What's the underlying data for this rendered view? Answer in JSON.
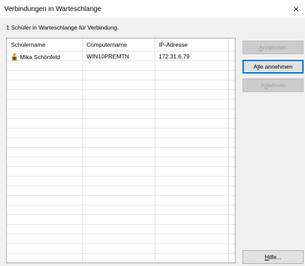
{
  "window": {
    "title": "Verbindungen in Warteschlange",
    "close_glyph": "×"
  },
  "info_text": "1 Schüler in Warteschlange für Verbindung.",
  "table": {
    "columns": [
      "Schülername",
      "Computername",
      "IP-Adresse"
    ],
    "rows": [
      {
        "student": "Mika Schönfeld",
        "computer": "WIN10PREMTN",
        "ip": "172.31.6.79",
        "icon": "student-icon"
      }
    ]
  },
  "buttons": {
    "accept": {
      "pre": "",
      "mnemonic": "A",
      "post": "nnehmen",
      "enabled": false
    },
    "accept_all": {
      "pre": "A",
      "mnemonic": "l",
      "post": "le annehmen",
      "enabled": true
    },
    "reject": {
      "pre": "A",
      "mnemonic": "b",
      "post": "lehnen",
      "enabled": false
    },
    "help": {
      "pre": "",
      "mnemonic": "H",
      "post": "ilfe...",
      "enabled": true
    }
  },
  "colors": {
    "accent": "#0078d7",
    "disabled_text": "#a0a0a0"
  }
}
